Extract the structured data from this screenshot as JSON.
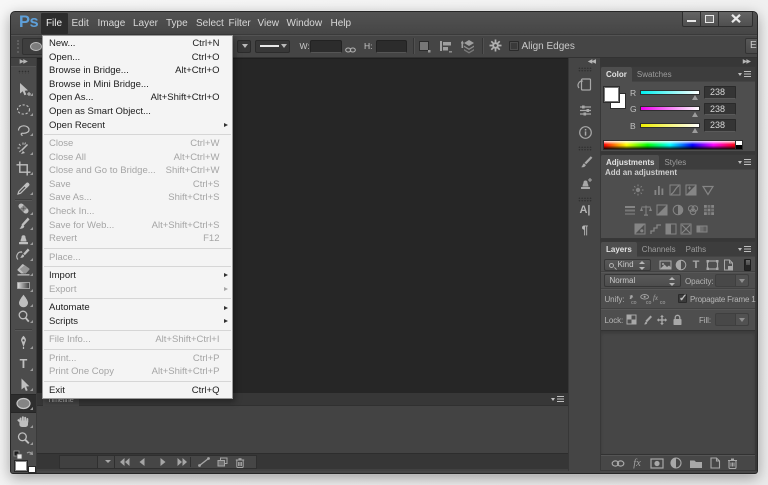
{
  "colors": {
    "ps_logo_blue": "#5e9fd8",
    "menu_highlight": "#2d2d2d",
    "ui_chrome": "#474747",
    "canvas": "#262626",
    "menu_bg": "#f4f4f4"
  },
  "window": {
    "logo": "Ps",
    "controls": [
      {
        "name": "minimize"
      },
      {
        "name": "maximize"
      },
      {
        "name": "close"
      }
    ]
  },
  "menu_bar": {
    "items": [
      "File",
      "Edit",
      "Image",
      "Layer",
      "Type",
      "Select",
      "Filter",
      "View",
      "Window",
      "Help"
    ],
    "active": "File"
  },
  "file_menu": {
    "items": [
      {
        "label": "New...",
        "shortcut": "Ctrl+N",
        "enabled": true
      },
      {
        "label": "Open...",
        "shortcut": "Ctrl+O",
        "enabled": true
      },
      {
        "label": "Browse in Bridge...",
        "shortcut": "Alt+Ctrl+O",
        "enabled": true
      },
      {
        "label": "Browse in Mini Bridge...",
        "enabled": true
      },
      {
        "label": "Open As...",
        "shortcut": "Alt+Shift+Ctrl+O",
        "enabled": true
      },
      {
        "label": "Open as Smart Object...",
        "enabled": true
      },
      {
        "label": "Open Recent",
        "submenu": true,
        "enabled": true
      },
      {
        "separator": true
      },
      {
        "label": "Close",
        "shortcut": "Ctrl+W",
        "enabled": false
      },
      {
        "label": "Close All",
        "shortcut": "Alt+Ctrl+W",
        "enabled": false
      },
      {
        "label": "Close and Go to Bridge...",
        "shortcut": "Shift+Ctrl+W",
        "enabled": false
      },
      {
        "label": "Save",
        "shortcut": "Ctrl+S",
        "enabled": false
      },
      {
        "label": "Save As...",
        "shortcut": "Shift+Ctrl+S",
        "enabled": false
      },
      {
        "label": "Check In...",
        "enabled": false
      },
      {
        "label": "Save for Web...",
        "shortcut": "Alt+Shift+Ctrl+S",
        "enabled": false
      },
      {
        "label": "Revert",
        "shortcut": "F12",
        "enabled": false
      },
      {
        "separator": true
      },
      {
        "label": "Place...",
        "enabled": false
      },
      {
        "separator": true
      },
      {
        "label": "Import",
        "submenu": true,
        "enabled": true
      },
      {
        "label": "Export",
        "submenu": true,
        "enabled": false
      },
      {
        "separator": true
      },
      {
        "label": "Automate",
        "submenu": true,
        "enabled": true
      },
      {
        "label": "Scripts",
        "submenu": true,
        "enabled": true
      },
      {
        "separator": true
      },
      {
        "label": "File Info...",
        "shortcut": "Alt+Shift+Ctrl+I",
        "enabled": false
      },
      {
        "separator": true
      },
      {
        "label": "Print...",
        "shortcut": "Ctrl+P",
        "enabled": false
      },
      {
        "label": "Print One Copy",
        "shortcut": "Alt+Shift+Ctrl+P",
        "enabled": false
      },
      {
        "separator": true
      },
      {
        "label": "Exit",
        "shortcut": "Ctrl+Q",
        "enabled": true
      }
    ]
  },
  "options_bar": {
    "tool_icon": "ellipse-tool-icon",
    "w_label": "W:",
    "w_value": "",
    "link_icon": "link-dimensions-icon",
    "h_label": "H:",
    "h_value": "",
    "icons": [
      "path-operations-icon",
      "path-alignment-icon",
      "path-arrangement-icon"
    ],
    "gear_icon": "geometry-options-gear-icon",
    "align_edges_label": "Align Edges",
    "align_edges_checked": false,
    "workspace_button": "E"
  },
  "toolbar": {
    "collapse_icon": "double-chevron-right-icon",
    "tools": [
      {
        "name": "move"
      },
      {
        "name": "marquee"
      },
      {
        "name": "lasso"
      },
      {
        "name": "magic-wand"
      },
      {
        "name": "crop"
      },
      {
        "name": "eyedropper"
      },
      {
        "name": "healing-brush"
      },
      {
        "name": "brush"
      },
      {
        "name": "clone-stamp"
      },
      {
        "name": "history-brush"
      },
      {
        "name": "eraser"
      },
      {
        "name": "gradient"
      },
      {
        "name": "blur"
      },
      {
        "name": "dodge"
      },
      {
        "name": "pen"
      },
      {
        "name": "type"
      },
      {
        "name": "path-selection"
      },
      {
        "name": "ellipse",
        "selected": true
      },
      {
        "name": "hand"
      },
      {
        "name": "zoom"
      }
    ],
    "foreground_color": "#ffffff",
    "background_color": "#ffffff"
  },
  "dock_strip": {
    "collapse_icon": "double-chevron-left-icon",
    "icons": [
      "history",
      "properties",
      "info",
      "brush-panel",
      "clone-source",
      "character",
      "paragraph"
    ]
  },
  "panels": {
    "expand_icon": "double-chevron-right-icon",
    "color": {
      "tabs": [
        "Color",
        "Swatches"
      ],
      "active_tab": "Color",
      "sliders": [
        {
          "label": "R",
          "value": "238"
        },
        {
          "label": "G",
          "value": "238"
        },
        {
          "label": "B",
          "value": "238"
        }
      ],
      "slider_position": 0.93
    },
    "adjustments": {
      "tabs": [
        "Adjustments",
        "Styles"
      ],
      "active_tab": "Adjustments",
      "heading": "Add an adjustment",
      "icon_rows": [
        [
          "brightness-contrast",
          "levels",
          "curves",
          "exposure",
          "vibrance"
        ],
        [
          "hue-saturation",
          "color-balance",
          "black-white",
          "photo-filter",
          "channel-mixer",
          "color-lookup"
        ],
        [
          "invert",
          "posterize",
          "threshold",
          "selective-color",
          "gradient-map"
        ]
      ]
    },
    "layers": {
      "tabs": [
        "Layers",
        "Channels",
        "Paths"
      ],
      "active_tab": "Layers",
      "kind_label": "Kind",
      "filter_icons": [
        "pixel-layer-filter",
        "adjustment-layer-filter",
        "type-layer-filter",
        "shape-layer-filter",
        "smart-object-filter"
      ],
      "blend_mode": "Normal",
      "opacity_label": "Opacity:",
      "unify_label": "Unify:",
      "unify_icons": [
        "unify-position",
        "unify-visibility",
        "unify-style"
      ],
      "propagate_label": "Propagate Frame 1",
      "propagate_checked": true,
      "lock_label": "Lock:",
      "lock_icons": [
        "lock-transparent",
        "lock-pixels",
        "lock-position",
        "lock-all"
      ],
      "fill_label": "Fill:",
      "bottom_icons": [
        "link-layers",
        "layer-style",
        "layer-mask",
        "new-adjustment-layer",
        "new-group",
        "new-layer",
        "delete-layer"
      ]
    }
  },
  "timeline": {
    "tab": "Timeline",
    "controls": [
      "first-frame",
      "previous-frame",
      "play",
      "next-frame",
      "tween",
      "duplicate-frame",
      "delete-frame"
    ]
  }
}
